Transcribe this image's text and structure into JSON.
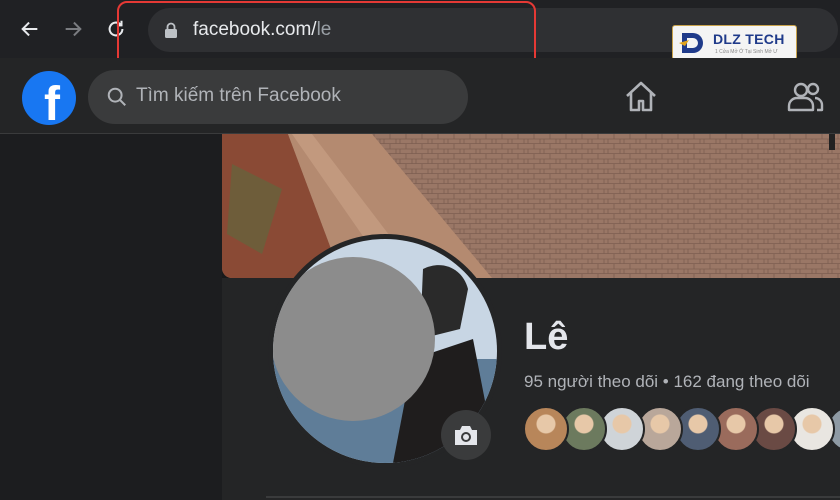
{
  "browser": {
    "url_main": "facebook.com/",
    "url_tail": "le",
    "icons": [
      "back-icon",
      "forward-icon",
      "reload-icon",
      "lock-icon"
    ]
  },
  "watermark": {
    "brand": "DLZ TECH",
    "tagline": "1 Cửa Mở Ở Tại Sinh Mở Ư"
  },
  "facebook": {
    "search_placeholder": "Tìm kiếm trên Facebook",
    "header_icons": [
      "home-icon",
      "friends-icon"
    ]
  },
  "profile": {
    "name": "Lê",
    "stats": "95 người theo dõi • 162 đang theo dõi",
    "friend_avatar_colors": [
      "#b8865a",
      "#6c7a5e",
      "#cfd4d8",
      "#b9a79a",
      "#4f5d73",
      "#9a6b5c",
      "#6a4a44",
      "#e9e6e1",
      "#8e9aa4"
    ]
  },
  "colors": {
    "fb_blue": "#1877f2",
    "highlight": "#e53935",
    "dark_bg": "#18191a",
    "card_bg": "#242526"
  }
}
